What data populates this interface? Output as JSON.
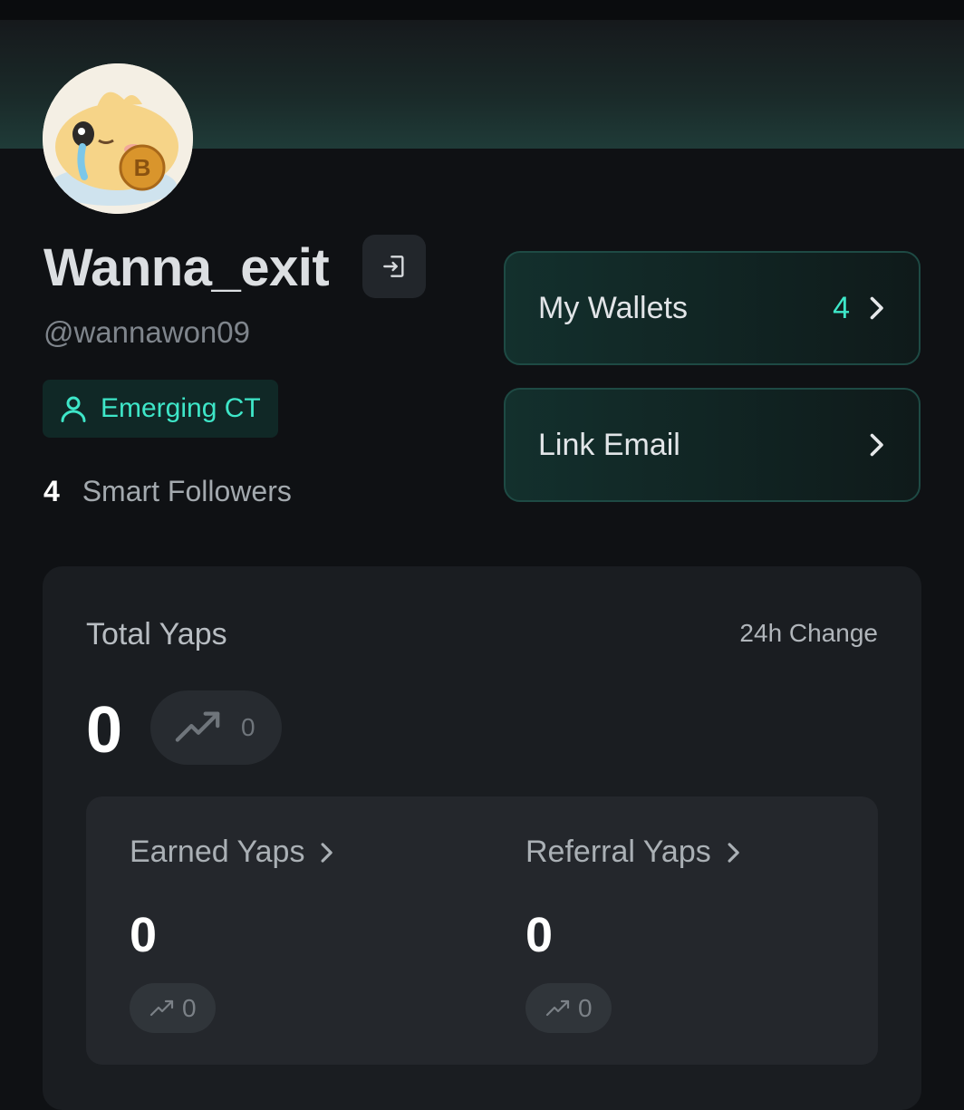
{
  "profile": {
    "display_name": "Wanna_exit",
    "handle": "@wannawon09",
    "badge_label": "Emerging CT",
    "smart_followers_count": "4",
    "smart_followers_label": "Smart Followers"
  },
  "actions": {
    "wallets_label": "My Wallets",
    "wallets_count": "4",
    "email_label": "Link Email"
  },
  "stats": {
    "total_label": "Total Yaps",
    "change_label": "24h Change",
    "total_value": "0",
    "total_change": "0",
    "earned_label": "Earned Yaps",
    "earned_value": "0",
    "earned_change": "0",
    "referral_label": "Referral Yaps",
    "referral_value": "0",
    "referral_change": "0"
  },
  "colors": {
    "accent": "#3ee6c8",
    "background": "#0f1114",
    "card": "#1a1d21"
  },
  "icons": {
    "logout": "logout-icon",
    "badge": "user-icon",
    "trend": "trending-up-icon",
    "chevron": "chevron-right-icon"
  }
}
